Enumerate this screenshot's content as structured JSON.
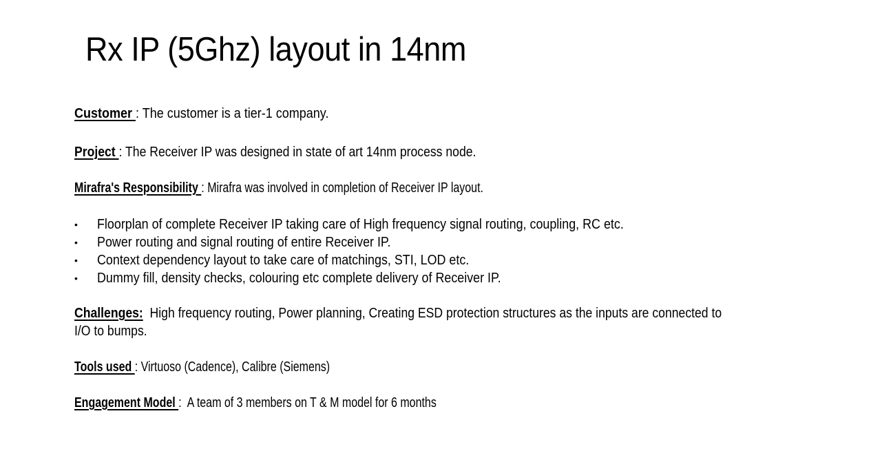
{
  "slide": {
    "title": "Rx IP (5Ghz) layout in 14nm"
  },
  "sections": {
    "customer": {
      "label": "Customer ",
      "separator": ": ",
      "text": "The customer is a tier-1 company."
    },
    "project": {
      "label": "Project ",
      "separator": ": ",
      "text": "The Receiver IP was designed in state of art 14nm process node."
    },
    "responsibility": {
      "label": "Mirafra's Responsibility ",
      "separator": ": ",
      "text": "Mirafra was involved in completion of Receiver IP layout."
    },
    "bullets": [
      "Floorplan of complete Receiver IP taking care of High frequency signal routing, coupling, RC etc.",
      "Power routing and signal routing of entire Receiver IP.",
      "Context dependency layout to take care of matchings, STI, LOD etc.",
      "Dummy fill, density checks, colouring etc complete delivery of Receiver IP."
    ],
    "challenges": {
      "label": "Challenges:",
      "separator": "  ",
      "line1": "High frequency routing, Power planning, Creating ESD protection structures as the inputs are connected to",
      "line2": "I/O to bumps."
    },
    "tools": {
      "label": "Tools used ",
      "separator": ": ",
      "text": "Virtuoso (Cadence), Calibre (Siemens)"
    },
    "engagement": {
      "label": "Engagement Model ",
      "separator": ":  ",
      "text": "A team of 3 members on T & M model for 6 months"
    },
    "bullet_glyph": "•"
  }
}
